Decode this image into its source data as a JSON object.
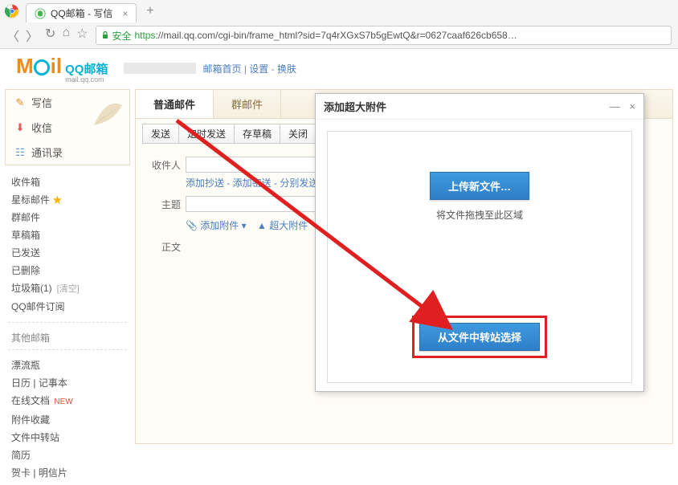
{
  "browser": {
    "tab_title": "QQ邮箱 - 写信",
    "secure_label": "安全",
    "url_proto": "https",
    "url_rest": "://mail.qq.com/cgi-bin/frame_html?sid=7q4rXGxS7b5gEwtQ&r=0627caaf626cb658…"
  },
  "logo": {
    "cn": "QQ邮箱",
    "en": "mail.qq.com"
  },
  "header_links": {
    "home": "邮箱首页",
    "settings": "设置",
    "skin": "换肤"
  },
  "sidebar_top": {
    "compose": "写信",
    "receive": "收信",
    "contacts": "通讯录"
  },
  "sidebar_folders": {
    "inbox": "收件箱",
    "starred": "星标邮件",
    "group": "群邮件",
    "drafts": "草稿箱",
    "sent": "已发送",
    "deleted": "已删除",
    "trash": "垃圾箱(1)",
    "trash_empty": "[清空]",
    "subscribe": "QQ邮件订阅"
  },
  "sidebar_other_label": "其他邮箱",
  "sidebar_apps": {
    "drift": "漂流瓶",
    "calendar": "日历",
    "notes": "记事本",
    "docs": "在线文档",
    "new_tag": "NEW",
    "attach_store": "附件收藏",
    "file_transfer": "文件中转站",
    "resume": "简历",
    "cards": "贺卡",
    "postcard": "明信片"
  },
  "mail_tabs": {
    "normal": "普通邮件",
    "group": "群邮件"
  },
  "toolbar": {
    "send": "发送",
    "timed": "定时发送",
    "draft": "存草稿",
    "close": "关闭"
  },
  "form": {
    "to_label": "收件人",
    "cc_links": "添加抄送 - 添加密送 - 分别发送",
    "subject_label": "主题",
    "attach": "添加附件",
    "bigattach": "超大附件",
    "body_label": "正文"
  },
  "dialog": {
    "title": "添加超大附件",
    "upload_btn": "上传新文件…",
    "drop_hint": "将文件拖拽至此区域",
    "transfer_btn": "从文件中转站选择"
  }
}
